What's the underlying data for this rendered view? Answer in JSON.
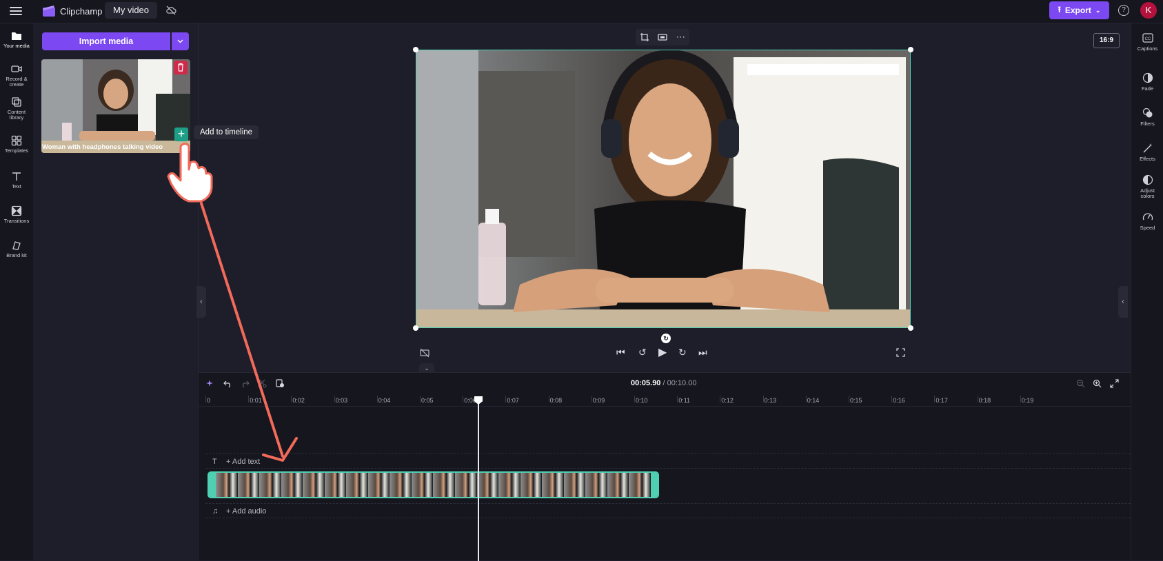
{
  "topbar": {
    "app_name": "Clipchamp",
    "project_title": "My video",
    "export_label": "Export",
    "avatar_initial": "K"
  },
  "leftnav": {
    "items": [
      {
        "label": "Your media",
        "icon": "folder-icon"
      },
      {
        "label": "Record & create",
        "icon": "camera-icon"
      },
      {
        "label": "Content library",
        "icon": "library-icon"
      },
      {
        "label": "Templates",
        "icon": "templates-icon"
      },
      {
        "label": "Text",
        "icon": "text-icon"
      },
      {
        "label": "Transitions",
        "icon": "transitions-icon"
      },
      {
        "label": "Brand kit",
        "icon": "brand-kit-icon"
      }
    ]
  },
  "media": {
    "import_label": "Import media",
    "clip_title": "Woman with headphones talking video",
    "tooltip": "Add to timeline"
  },
  "preview": {
    "aspect_ratio": "16:9"
  },
  "rightpanel": {
    "items": [
      {
        "label": "Captions",
        "icon": "captions-icon"
      },
      {
        "label": "Fade",
        "icon": "fade-icon"
      },
      {
        "label": "Filters",
        "icon": "filters-icon"
      },
      {
        "label": "Effects",
        "icon": "effects-icon"
      },
      {
        "label": "Adjust colors",
        "icon": "adjust-colors-icon"
      },
      {
        "label": "Speed",
        "icon": "speed-icon"
      }
    ]
  },
  "timeline": {
    "current_time": "00:05.90",
    "total_time": "/ 00:10.00",
    "ruler_labels": [
      "0",
      "0:01",
      "0:02",
      "0:03",
      "0:04",
      "0:05",
      "0:06",
      "0:07",
      "0:08",
      "0:09",
      "0:10",
      "0:11",
      "0:12",
      "0:13",
      "0:14",
      "0:15",
      "0:16",
      "0:17",
      "0:18",
      "0:19"
    ],
    "add_text_label": "+ Add text",
    "add_audio_label": "+ Add audio"
  },
  "colors": {
    "accent": "#7b48f2",
    "selection": "#4fd0b2",
    "annotation_arrow": "#f26a5a",
    "delete": "#d02a4a"
  }
}
